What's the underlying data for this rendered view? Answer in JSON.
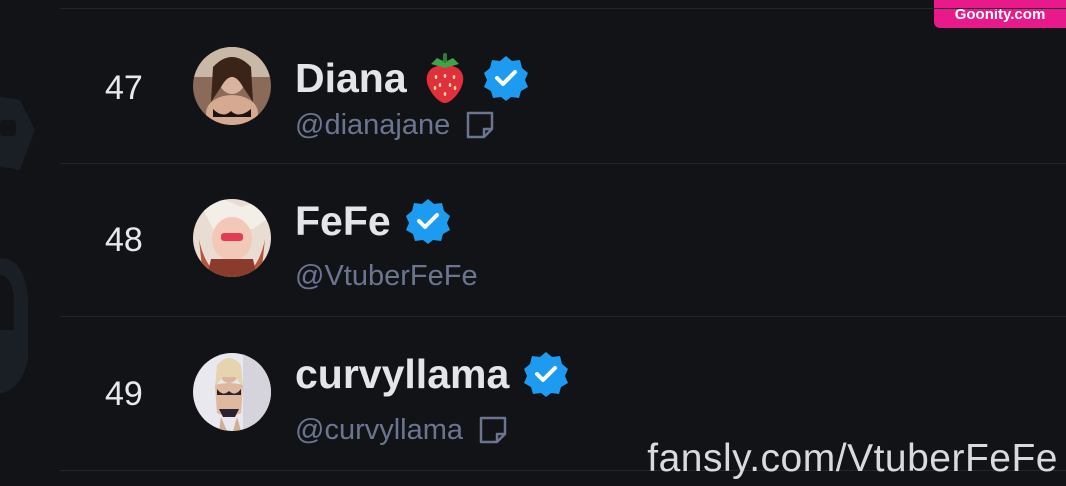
{
  "header": {
    "badge_text": "Goonity.com"
  },
  "rows": [
    {
      "rank": "47",
      "name": "Diana",
      "emoji": "strawberry-icon",
      "handle": "@dianajane",
      "verified": true,
      "note_icon": true
    },
    {
      "rank": "48",
      "name": "FeFe",
      "handle": "@VtuberFeFe",
      "verified": true,
      "note_icon": false
    },
    {
      "rank": "49",
      "name": "curvyllama",
      "handle": "@curvyllama",
      "verified": true,
      "note_icon": true
    }
  ],
  "watermark": {
    "text": "fansly.com/VtuberFeFe"
  },
  "colors": {
    "background": "#111317",
    "verified_blue": "#1d9bf0",
    "handle_gray": "#6c7590",
    "badge_pink": "#e8198b"
  }
}
